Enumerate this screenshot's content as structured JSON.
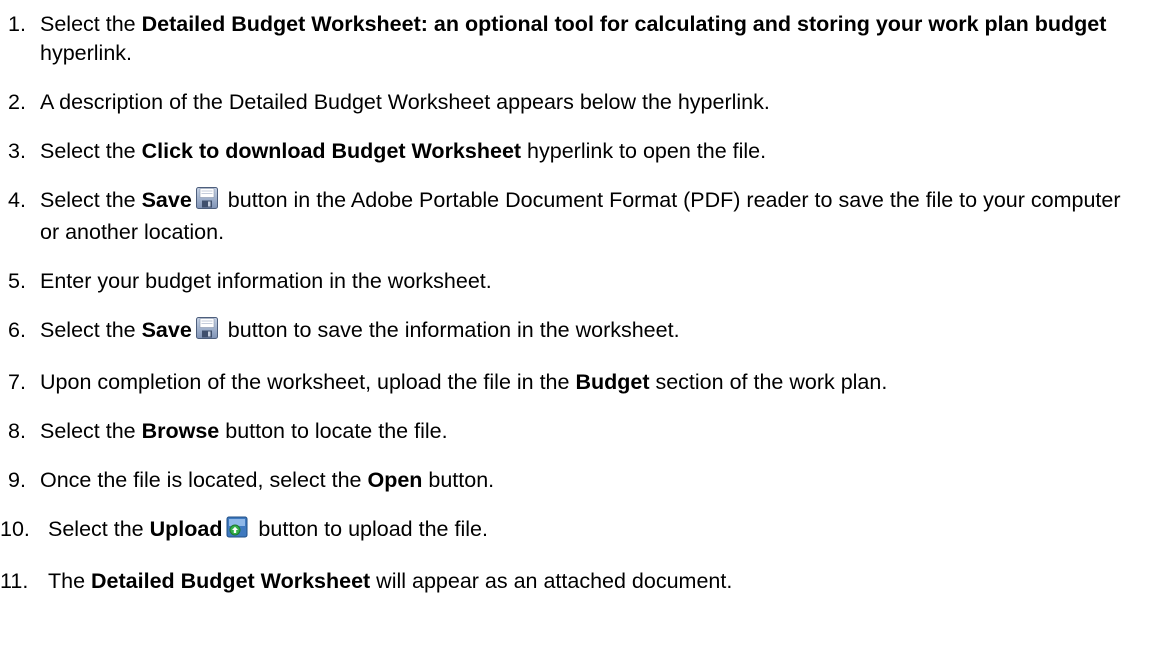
{
  "steps": [
    {
      "num": "1.",
      "parts": [
        {
          "t": "Select the "
        },
        {
          "t": "Detailed Budget Worksheet: an optional tool for calculating and storing your work plan budget",
          "b": true
        },
        {
          "t": " hyperlink."
        }
      ]
    },
    {
      "num": "2.",
      "parts": [
        {
          "t": "A description of the Detailed Budget Worksheet appears below the hyperlink."
        }
      ]
    },
    {
      "num": "3.",
      "parts": [
        {
          "t": "Select the "
        },
        {
          "t": "Click to download Budget Worksheet",
          "b": true
        },
        {
          "t": " hyperlink to open the file."
        }
      ]
    },
    {
      "num": "4.",
      "parts": [
        {
          "t": "Select the "
        },
        {
          "t": "Save",
          "b": true
        },
        {
          "icon": "save-icon"
        },
        {
          "t": " button in the Adobe Portable Document Format (PDF) reader to save the file to your computer or another location."
        }
      ]
    },
    {
      "num": "5.",
      "parts": [
        {
          "t": "Enter your budget information in the worksheet."
        }
      ]
    },
    {
      "num": "6.",
      "parts": [
        {
          "t": "Select the "
        },
        {
          "t": "Save",
          "b": true
        },
        {
          "icon": "save-icon"
        },
        {
          "t": " button to save the information in the worksheet."
        }
      ]
    },
    {
      "num": "7.",
      "parts": [
        {
          "t": "Upon completion of the worksheet, upload the file in the "
        },
        {
          "t": "Budget",
          "b": true
        },
        {
          "t": " section of the work plan."
        }
      ]
    },
    {
      "num": "8.",
      "parts": [
        {
          "t": "Select the "
        },
        {
          "t": "Browse",
          "b": true
        },
        {
          "t": " button to locate the file."
        }
      ]
    },
    {
      "num": "9.",
      "parts": [
        {
          "t": "Once the file is located, select the "
        },
        {
          "t": "Open",
          "b": true
        },
        {
          "t": " button."
        }
      ]
    },
    {
      "num": "10.",
      "parts": [
        {
          "t": "Select the "
        },
        {
          "t": "Upload",
          "b": true
        },
        {
          "icon": "upload-icon"
        },
        {
          "t": " button to upload the file."
        }
      ]
    },
    {
      "num": "11.",
      "parts": [
        {
          "t": "The "
        },
        {
          "t": "Detailed Budget Worksheet",
          "b": true
        },
        {
          "t": " will appear as an attached document."
        }
      ]
    }
  ]
}
